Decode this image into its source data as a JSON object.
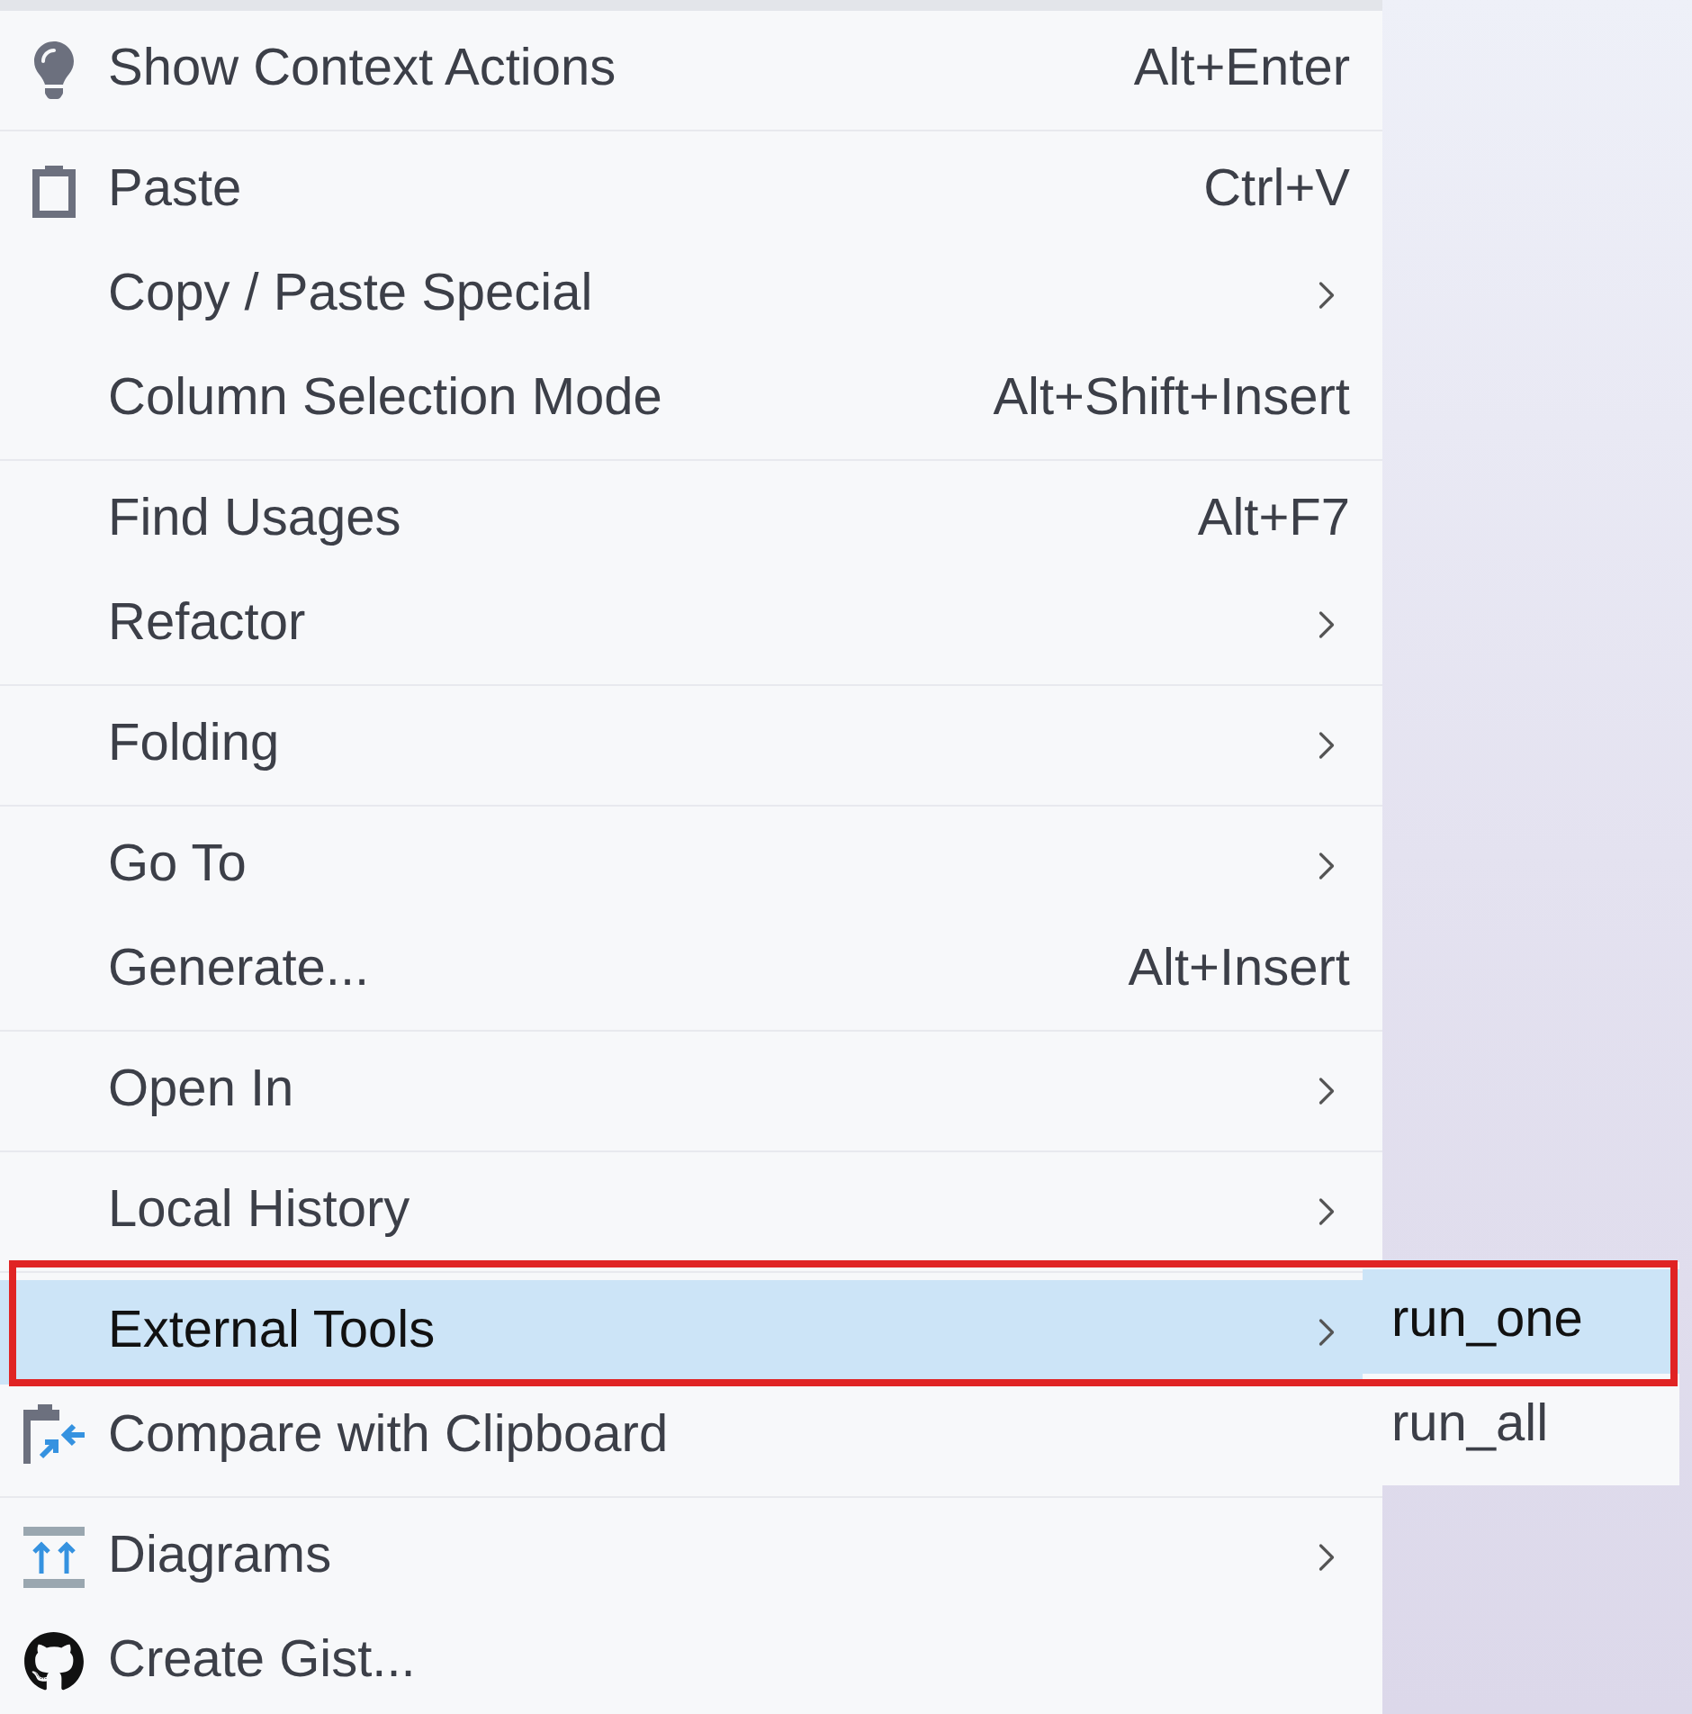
{
  "menu": {
    "groups": [
      {
        "items": [
          {
            "label": "Show Context Actions",
            "shortcut": "Alt+Enter",
            "submenu": false,
            "selected": false
          }
        ]
      },
      {
        "items": [
          {
            "label": "Paste",
            "shortcut": "Ctrl+V",
            "submenu": false,
            "selected": false
          },
          {
            "label": "Copy / Paste Special",
            "submenu": true,
            "selected": false
          },
          {
            "label": "Column Selection Mode",
            "shortcut": "Alt+Shift+Insert",
            "submenu": false,
            "selected": false
          }
        ]
      },
      {
        "items": [
          {
            "label": "Find Usages",
            "shortcut": "Alt+F7",
            "submenu": false,
            "selected": false
          },
          {
            "label": "Refactor",
            "submenu": true,
            "selected": false
          }
        ]
      },
      {
        "items": [
          {
            "label": "Folding",
            "submenu": true,
            "selected": false
          }
        ]
      },
      {
        "items": [
          {
            "label": "Go To",
            "submenu": true,
            "selected": false
          },
          {
            "label": "Generate...",
            "shortcut": "Alt+Insert",
            "submenu": false,
            "selected": false
          }
        ]
      },
      {
        "items": [
          {
            "label": "Open In",
            "submenu": true,
            "selected": false
          }
        ]
      },
      {
        "items": [
          {
            "label": "Local History",
            "submenu": true,
            "selected": false
          }
        ]
      },
      {
        "items": [
          {
            "label": "External Tools",
            "submenu": true,
            "selected": true
          },
          {
            "label": "Compare with Clipboard",
            "submenu": false,
            "selected": false
          }
        ]
      },
      {
        "items": [
          {
            "label": "Diagrams",
            "submenu": true,
            "selected": false
          },
          {
            "label": "Create Gist...",
            "submenu": false,
            "selected": false
          }
        ]
      }
    ]
  },
  "submenu": {
    "items": [
      {
        "label": "run_one",
        "selected": true
      },
      {
        "label": "run_all",
        "selected": false
      }
    ]
  }
}
